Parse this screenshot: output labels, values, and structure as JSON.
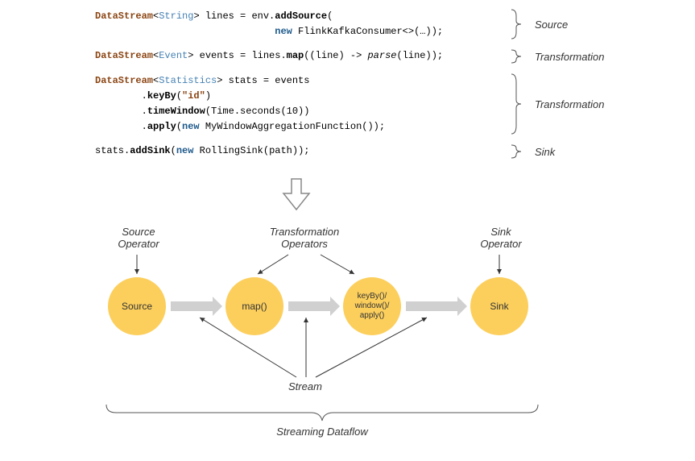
{
  "code": {
    "line1": {
      "p1": "DataStream",
      "p2": "<",
      "p3": "String",
      "p4": "> lines = env.",
      "p5": "addSource",
      "p6": "(",
      "p7indent": "                               ",
      "p8": "new",
      "p9": " FlinkKafkaConsumer<>(…));"
    },
    "label1": "Source",
    "line2": {
      "p1": "DataStream",
      "p2": "<",
      "p3": "Event",
      "p4": "> events = lines.",
      "p5": "map",
      "p6": "((line) -> ",
      "p7": "parse",
      "p8": "(line));"
    },
    "label2": "Transformation",
    "line3": {
      "p1": "DataStream",
      "p2": "<",
      "p3": "Statistics",
      "p4": "> stats = events",
      "l2a": "        .",
      "l2b": "keyBy",
      "l2c": "(",
      "l2d": "\"id\"",
      "l2e": ")",
      "l3a": "        .",
      "l3b": "timeWindow",
      "l3c": "(Time.seconds(10))",
      "l4a": "        .",
      "l4b": "apply",
      "l4c": "(",
      "l4d": "new",
      "l4e": " MyWindowAggregationFunction());"
    },
    "label3": "Transformation",
    "line4": {
      "p1": "stats.",
      "p2": "addSink",
      "p3": "(",
      "p4": "new",
      "p5": " RollingSink(path));"
    },
    "label4": "Sink"
  },
  "diagram": {
    "labels": {
      "source_op": "Source\nOperator",
      "trans_op": "Transformation\nOperators",
      "sink_op": "Sink\nOperator"
    },
    "nodes": {
      "source": "Source",
      "map": "map()",
      "keyby": "keyBy()/\nwindow()/\napply()",
      "sink": "Sink"
    },
    "stream": "Stream",
    "dataflow": "Streaming Dataflow"
  }
}
